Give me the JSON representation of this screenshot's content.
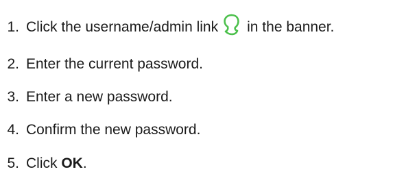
{
  "steps": [
    {
      "number": "1.",
      "text_before_icon": "Click the username/admin link",
      "icon": "user-profile-icon",
      "text_after_icon": "in the banner."
    },
    {
      "number": "2.",
      "text": "Enter the current password."
    },
    {
      "number": "3.",
      "text": "Enter a new password."
    },
    {
      "number": "4.",
      "text": "Confirm the new password."
    },
    {
      "number": "5.",
      "text_before": "Click ",
      "bold": "OK",
      "text_after": "."
    }
  ],
  "colors": {
    "icon_stroke": "#4cc04c",
    "text": "#1a1a1a"
  }
}
